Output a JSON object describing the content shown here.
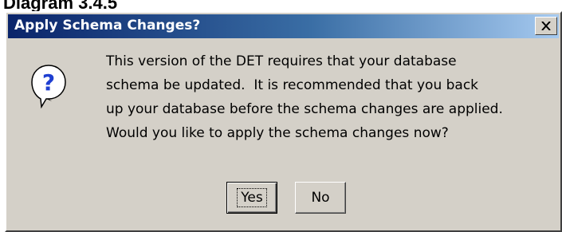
{
  "caption": "Diagram 3.4.5",
  "dialog": {
    "title": "Apply Schema Changes?",
    "close_glyph": "✕",
    "icon": "question-icon",
    "icon_glyph": "?",
    "message_lines": [
      "This version of the DET requires that your database",
      "schema be updated.  It is recommended that you back",
      "up your database before the schema changes are applied.",
      "Would you like to apply the schema changes now?"
    ],
    "buttons": {
      "yes_label": "Yes",
      "no_label": "No"
    }
  },
  "colors": {
    "titlebar_start": "#0a246a",
    "titlebar_end": "#a6caf0",
    "face": "#d4d0c8",
    "icon_blue": "#1f3fd1"
  }
}
